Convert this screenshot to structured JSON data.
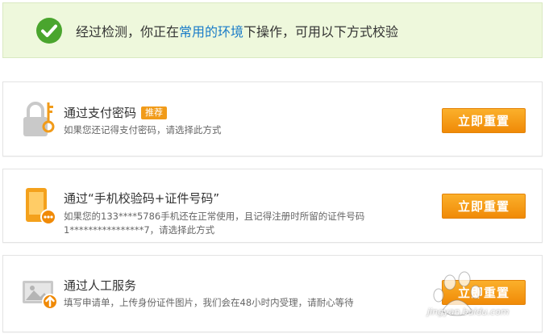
{
  "notice": {
    "prefix": "经过检测，你正在",
    "highlight": "常用的环境",
    "suffix": "下操作，可用以下方式校验"
  },
  "methods": [
    {
      "title": "通过支付密码",
      "badge": "推荐",
      "desc": "如果您还记得支付密码，请选择此方式",
      "button": "立即重置",
      "icon": "lock-key-icon"
    },
    {
      "title": "通过“手机校验码+证件号码”",
      "desc": "如果您的133****5786手机还在正常使用，且记得注册时所留的证件号码1****************7，请选择此方式",
      "button": "立即重置",
      "icon": "phone-icon"
    },
    {
      "title": "通过人工服务",
      "desc": "填写申请单，上传身份证件图片，我们会在48小时内受理，请耐心等待",
      "button": "立即重置",
      "icon": "id-card-upload-icon"
    }
  ],
  "watermark": "jingyan.baidu.com",
  "colors": {
    "accent_button": "#f08a07",
    "highlight_link": "#1a7cc8",
    "notice_bg": "#eef8dc",
    "check_green": "#4aa52e"
  }
}
